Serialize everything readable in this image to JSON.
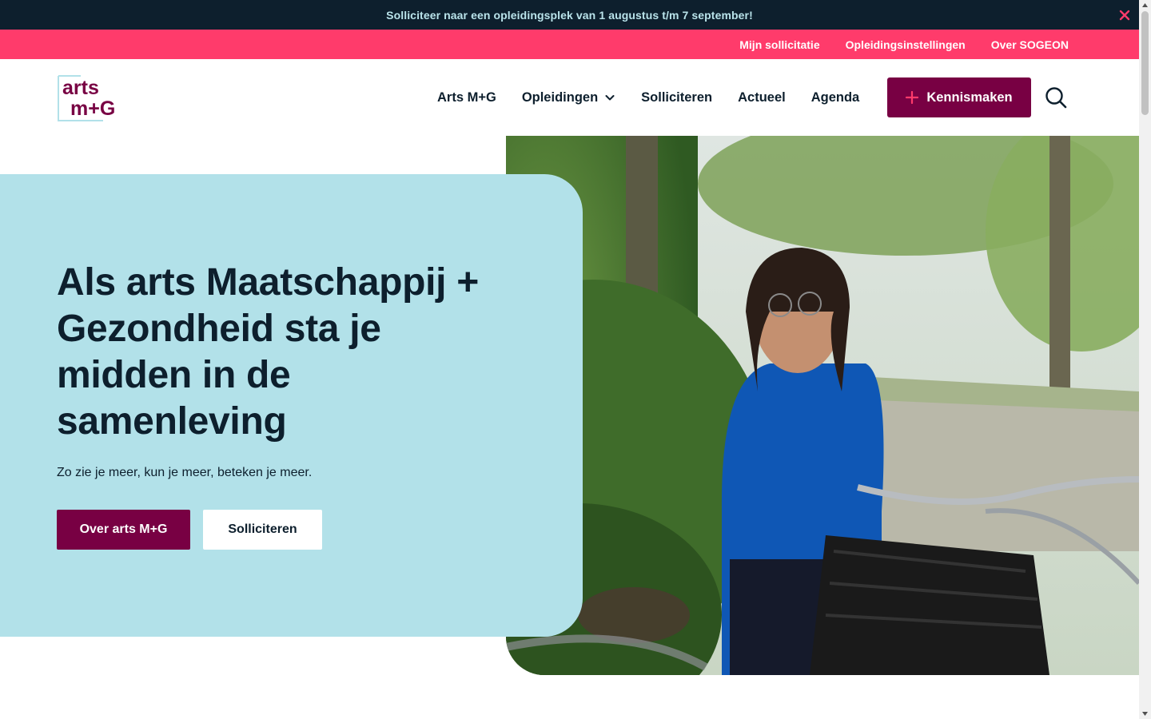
{
  "announcement": {
    "text": "Solliciteer naar een opleidingsplek van 1 augustus t/m 7 september!",
    "close_icon": "close-icon"
  },
  "utility_nav": {
    "items": [
      {
        "label": "Mijn sollicitatie"
      },
      {
        "label": "Opleidingsinstellingen"
      },
      {
        "label": "Over SOGEON"
      }
    ]
  },
  "header": {
    "logo_text_top": "arts",
    "logo_text_bottom": "m+G",
    "nav": [
      {
        "label": "Arts M+G"
      },
      {
        "label": "Opleidingen"
      },
      {
        "label": "Solliciteren"
      },
      {
        "label": "Actueel"
      },
      {
        "label": "Agenda"
      }
    ],
    "cta_label": "Kennismaken",
    "search_icon": "search-icon"
  },
  "hero": {
    "title": "Als arts Maatschappij + Gezondheid sta je midden in de samenleving",
    "subtitle": "Zo zie je meer, kun je meer, beteken je meer.",
    "primary_button": "Over arts M+G",
    "secondary_button": "Solliciteren",
    "image_alt": "Woman in blue shirt with bicycle outdoors"
  },
  "colors": {
    "announce_bg": "#0d1f2d",
    "announce_text": "#b9e3ea",
    "utility_bg": "#ff3b6b",
    "brand": "#780043",
    "hero_card": "#b2e1e9",
    "text_dark": "#0d1f2d"
  }
}
